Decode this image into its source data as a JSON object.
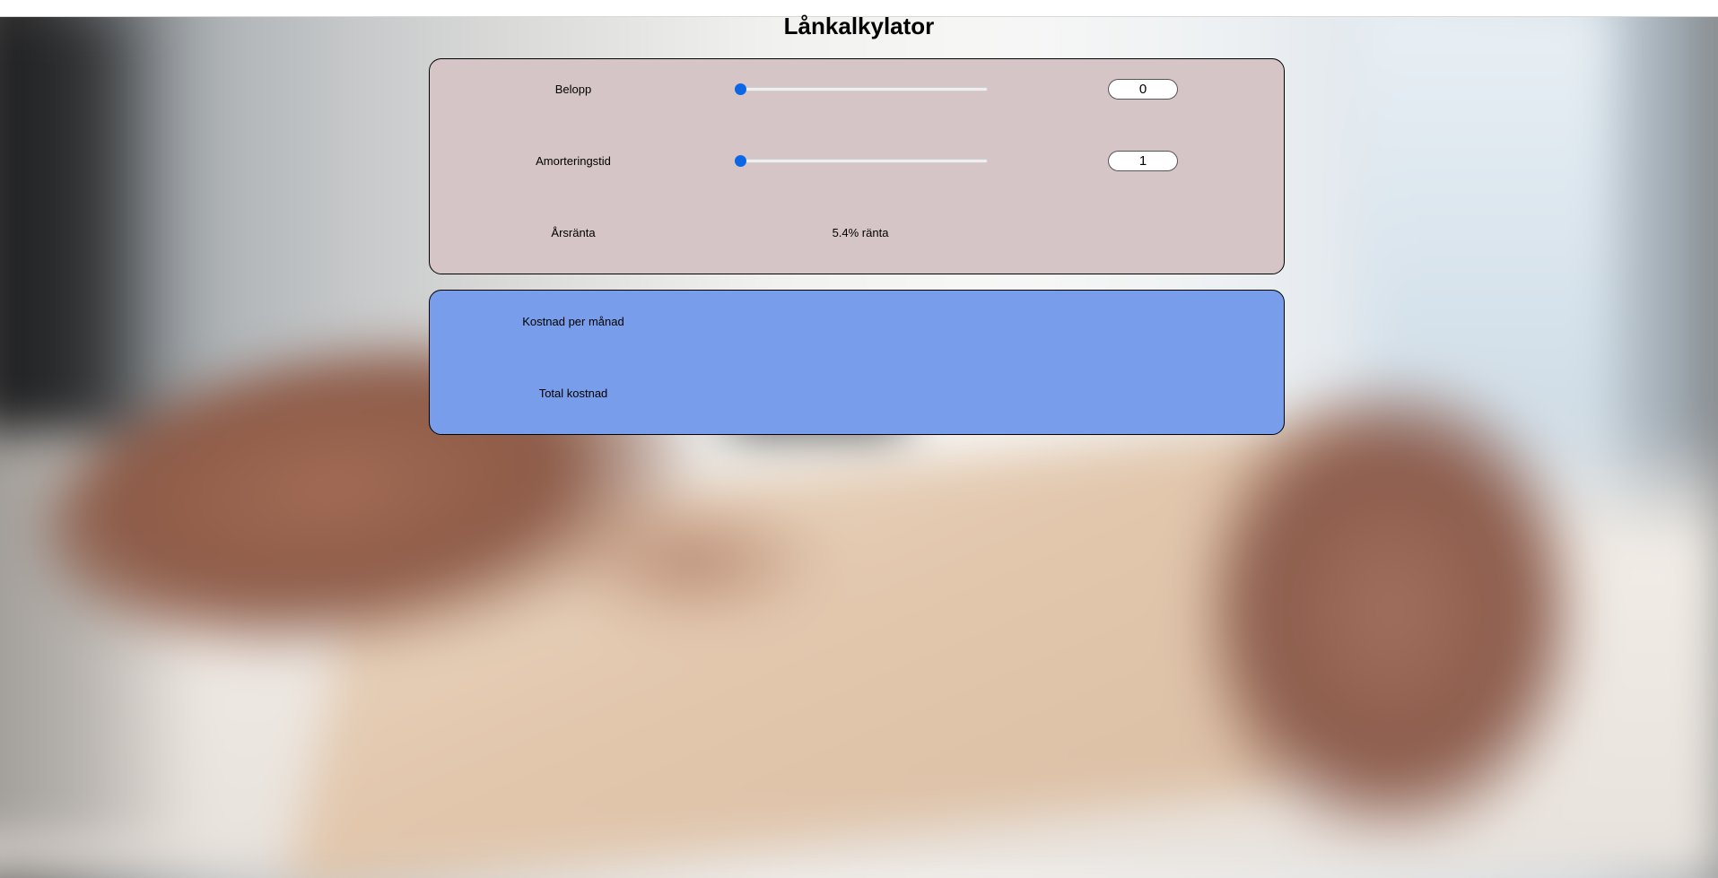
{
  "page": {
    "title": "Lånkalkylator"
  },
  "inputs": {
    "belopp": {
      "label": "Belopp",
      "value": "0",
      "slider_fraction": 0
    },
    "amortering": {
      "label": "Amorteringstid",
      "value": "1",
      "slider_fraction": 0
    },
    "rate": {
      "label": "Årsränta",
      "value_text": "5.4% ränta"
    }
  },
  "results": {
    "monthly": {
      "label": "Kostnad per månad",
      "value": ""
    },
    "total": {
      "label": "Total kostnad",
      "value": ""
    }
  },
  "colors": {
    "input_panel": "#d5c5c6",
    "result_panel": "#789eeb",
    "slider_accent": "#0b67e6"
  }
}
